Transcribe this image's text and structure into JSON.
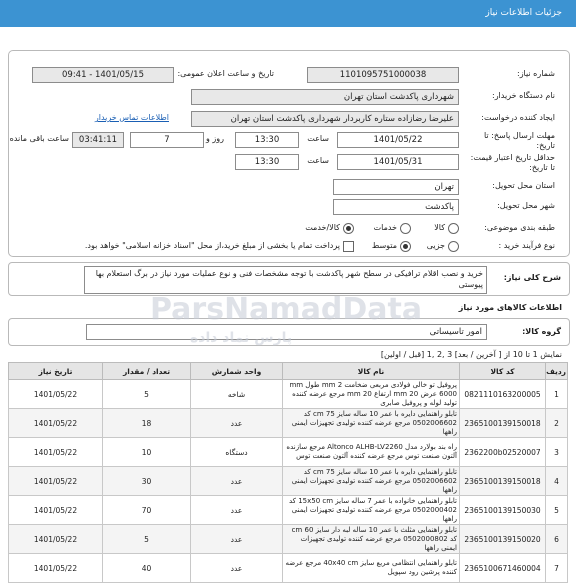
{
  "header": {
    "title": "جزئیات اطلاعات نیاز"
  },
  "fields": {
    "need_number_label": "شماره نیاز:",
    "need_number": "1101095751000038",
    "announce_label": "تاریخ و ساعت اعلان عمومی:",
    "announce_value": "1401/05/15 - 09:41",
    "buyer_label": "نام دستگاه خریدار:",
    "buyer_value": "شهرداری پاکدشت استان تهران",
    "creator_label": "ایجاد کننده درخواست:",
    "creator_value": "علیرضا رضازاده ستاره کاربردار شهرداری پاکدشت استان تهران",
    "contact_link": "اطلاعات تماس خریدار",
    "deadline_label": "مهلت ارسال پاسخ: تا تاریخ:",
    "deadline_date": "1401/05/22",
    "time_label": "ساعت",
    "deadline_time": "13:30",
    "days_value": "7",
    "days_label": "روز و",
    "remaining_time": "03:41:11",
    "remaining_label": "ساعت باقی مانده",
    "validity_label": "حداقل تاریخ اعتبار قیمت: تا تاریخ:",
    "validity_date": "1401/05/31",
    "validity_time": "13:30",
    "province_label": "استان محل تحویل:",
    "province_value": "تهران",
    "city_label": "شهر محل تحویل:",
    "city_value": "پاکدشت",
    "category_label": "طبقه بندی موضوعی:",
    "cat_goods": "کالا",
    "cat_service": "خدمات",
    "cat_goods_service": "کالا/خدمت",
    "process_label": "نوع فرآیند خرید :",
    "proc_partial": "جزیی",
    "proc_medium": "متوسط",
    "payment_note": "پرداخت تمام یا بخشی از مبلغ خرید،از محل \"اسناد خزانه اسلامی\" خواهد بود."
  },
  "description": {
    "label": "شرح کلی نیاز:",
    "text": "خرید و نصب اقلام ترافیکی در سطح شهر پاکدشت با توجه مشخصات فنی و نوع عملیات مورد نیاز در برگ استعلام بها پیوستی"
  },
  "goods_section": {
    "title": "اطلاعات کالاهای مورد نیاز",
    "group_label": "گروه کالا:",
    "group_value": "امور تاسیساتی",
    "pagination": "نمایش 1 تا 10 از [ آخرین / بعد] 3 ,2 ,1 [قبل / اولین]"
  },
  "table": {
    "headers": [
      "ردیف",
      "کد کالا",
      "نام کالا",
      "واحد شمارش",
      "تعداد / مقدار",
      "تاریخ نیاز"
    ],
    "rows": [
      {
        "row": "1",
        "code": "0821110163200005",
        "name": "پروفیل تو خالی فولادی مربعی ضخامت 2 mm طول mm 6000 عرض 20 mm ارتفاع 20 mm مرجع عرضه کننده تولید لوله و پروفیل صابری",
        "unit": "شاخه",
        "qty": "5",
        "date": "1401/05/22"
      },
      {
        "row": "2",
        "code": "2365100139150018",
        "name": "تابلو راهنمایی دایره با عمر 10 ساله سایز 75 cm کد 0502006602 مرجع عرضه کننده تولیدی تجهیزات ایمنی راهها",
        "unit": "عدد",
        "qty": "18",
        "date": "1401/05/22"
      },
      {
        "row": "3",
        "code": "2362200b02520007",
        "name": "راه بند بولارد مدل Altonco ALHB-LV2260 مرجع سازنده آلتون صنعت توس مرجع عرضه کننده آلتون صنعت توس",
        "unit": "دستگاه",
        "qty": "10",
        "date": "1401/05/22"
      },
      {
        "row": "4",
        "code": "2365100139150018",
        "name": "تابلو راهنمایی دایره با عمر 10 ساله سایز 75 cm کد 0502006602 مرجع عرضه کننده تولیدی تجهیزات ایمنی راهها",
        "unit": "عدد",
        "qty": "30",
        "date": "1401/05/22"
      },
      {
        "row": "5",
        "code": "2365100139150030",
        "name": "تابلو راهنمایی خانواده با عمر 7 ساله سایز 15x50 cm کد 0502000402 مرجع عرضه کننده تولیدی تجهیزات ایمنی راهها",
        "unit": "عدد",
        "qty": "70",
        "date": "1401/05/22"
      },
      {
        "row": "6",
        "code": "2365100139150020",
        "name": "تابلو راهنمایی مثلث با عمر 10 ساله لبه دار سایز 60 cm کد 0502000802 مرجع عرضه کننده تولیدی تجهیزات ایمنی راهها",
        "unit": "عدد",
        "qty": "5",
        "date": "1401/05/22"
      },
      {
        "row": "7",
        "code": "2365100671460004",
        "name": "تابلو راهنمایی انتظامی مربع سایز 40x40 cm مرجع عرضه کننده پرشین رود سپویل",
        "unit": "عدد",
        "qty": "40",
        "date": "1401/05/22"
      }
    ]
  },
  "watermark": {
    "brand": "ParsNamadData",
    "subtitle": "پارس نماد داده"
  }
}
